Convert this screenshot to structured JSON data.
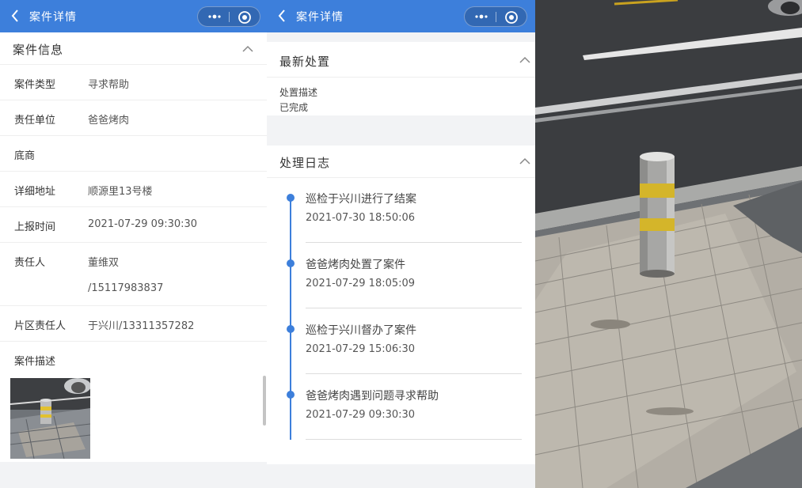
{
  "header": {
    "title": "案件详情"
  },
  "case_info": {
    "section_title": "案件信息",
    "fields": [
      {
        "label": "案件类型",
        "value": "寻求帮助"
      },
      {
        "label": "责任单位",
        "value": "爸爸烤肉"
      },
      {
        "label": "底商",
        "value": ""
      },
      {
        "label": "详细地址",
        "value": "顺源里13号楼"
      },
      {
        "label": "上报时间",
        "value": "2021-07-29 09:30:30"
      },
      {
        "label": "责任人",
        "value": "董维双",
        "value2": "/15117983837"
      },
      {
        "label": "片区责任人",
        "value": "于兴川/13311357282"
      },
      {
        "label": "案件描述",
        "value": ""
      }
    ]
  },
  "latest_disposal": {
    "section_title": "最新处置",
    "desc_label": "处置描述",
    "desc_value": "已完成"
  },
  "process_log": {
    "section_title": "处理日志",
    "entries": [
      {
        "title": "巡检于兴川进行了结案",
        "time": "2021-07-30 18:50:06"
      },
      {
        "title": "爸爸烤肉处置了案件",
        "time": "2021-07-29 18:05:09"
      },
      {
        "title": "巡检于兴川督办了案件",
        "time": "2021-07-29 15:06:30"
      },
      {
        "title": "爸爸烤肉遇到问题寻求帮助",
        "time": "2021-07-29 09:30:30"
      }
    ]
  },
  "icons": {
    "back": "chevron-left-icon",
    "more": "more-dots-icon",
    "close": "close-circle-icon",
    "collapse": "chevron-up-icon"
  },
  "colors": {
    "header_bg": "#3d7fdb",
    "timeline": "#3d7fdb",
    "page_bg": "#f2f3f5"
  }
}
